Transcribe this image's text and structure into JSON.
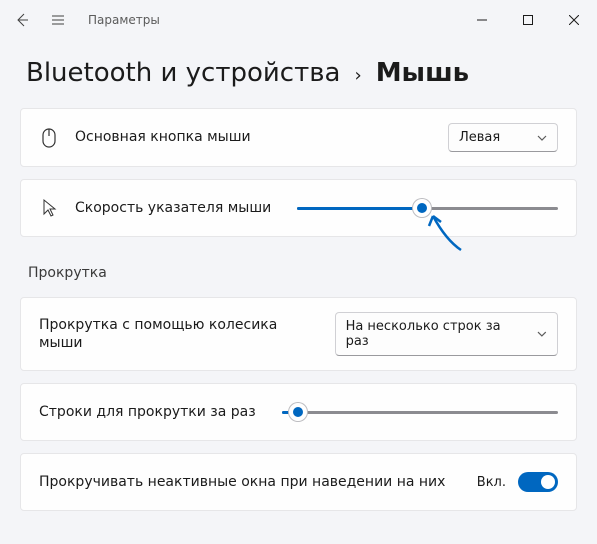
{
  "titlebar": {
    "title": "Параметры"
  },
  "breadcrumb": {
    "parent": "Bluetooth и устройства",
    "current": "Мышь"
  },
  "settings": {
    "primary_button": {
      "label": "Основная кнопка мыши",
      "value": "Левая"
    },
    "pointer_speed": {
      "label": "Скорость указателя мыши",
      "value_pct": 48
    },
    "scroll_section": "Прокрутка",
    "wheel_mode": {
      "label": "Прокрутка с помощью колесика мыши",
      "value": "На несколько строк за раз"
    },
    "lines_per_scroll": {
      "label": "Строки для прокрутки за раз",
      "value_pct": 6
    },
    "inactive_scroll": {
      "label": "Прокручивать неактивные окна при наведении на них",
      "state": "Вкл."
    }
  }
}
